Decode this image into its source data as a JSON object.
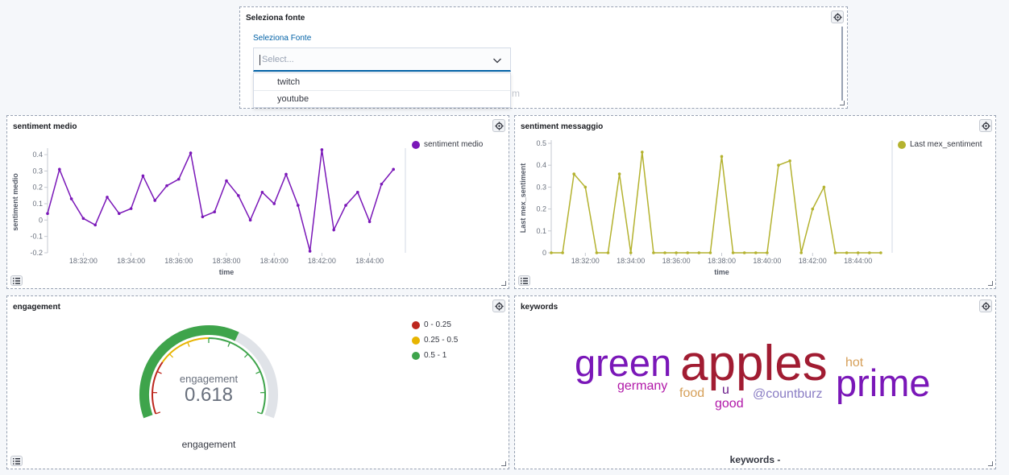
{
  "source_panel": {
    "title": "Seleziona fonte",
    "field_label": "Seleziona Fonte",
    "placeholder": "Select...",
    "options": [
      "twitch",
      "youtube"
    ],
    "hidden_fragment": "m"
  },
  "sentiment_medio": {
    "title": "sentiment medio",
    "chart_data": {
      "type": "line",
      "xlabel": "time",
      "ylabel": "sentiment medio",
      "x_ticks": [
        "18:32:00",
        "18:34:00",
        "18:36:00",
        "18:38:00",
        "18:40:00",
        "18:42:00",
        "18:44:00"
      ],
      "y_ticks": [
        "0.4",
        "0.3",
        "0.2",
        "0.1",
        "0",
        "-0.1",
        "-0.2"
      ],
      "ylim": [
        -0.2,
        0.42
      ],
      "xlim": [
        "18:30:30",
        "18:45:30"
      ],
      "series": [
        {
          "name": "sentiment medio",
          "color": "#7a17b8",
          "points": [
            [
              "18:30:30",
              0.04
            ],
            [
              "18:31:00",
              0.31
            ],
            [
              "18:31:30",
              0.13
            ],
            [
              "18:32:00",
              0.01
            ],
            [
              "18:32:30",
              -0.03
            ],
            [
              "18:33:00",
              0.14
            ],
            [
              "18:33:30",
              0.04
            ],
            [
              "18:34:00",
              0.07
            ],
            [
              "18:34:30",
              0.27
            ],
            [
              "18:35:00",
              0.12
            ],
            [
              "18:35:30",
              0.21
            ],
            [
              "18:36:00",
              0.25
            ],
            [
              "18:36:30",
              0.41
            ],
            [
              "18:37:00",
              0.02
            ],
            [
              "18:37:30",
              0.05
            ],
            [
              "18:38:00",
              0.24
            ],
            [
              "18:38:30",
              0.15
            ],
            [
              "18:39:00",
              0.0
            ],
            [
              "18:39:30",
              0.17
            ],
            [
              "18:40:00",
              0.1
            ],
            [
              "18:40:30",
              0.28
            ],
            [
              "18:41:00",
              0.09
            ],
            [
              "18:41:30",
              -0.19
            ],
            [
              "18:42:00",
              0.43
            ],
            [
              "18:42:30",
              -0.06
            ],
            [
              "18:43:00",
              0.09
            ],
            [
              "18:43:30",
              0.17
            ],
            [
              "18:44:00",
              -0.01
            ],
            [
              "18:44:30",
              0.22
            ],
            [
              "18:45:00",
              0.31
            ]
          ]
        }
      ],
      "legend": "top-right"
    }
  },
  "sentiment_messaggio": {
    "title": "sentiment messaggio",
    "chart_data": {
      "type": "line",
      "xlabel": "time",
      "ylabel": "Last mex_sentiment",
      "x_ticks": [
        "18:32:00",
        "18:34:00",
        "18:36:00",
        "18:38:00",
        "18:40:00",
        "18:42:00",
        "18:44:00"
      ],
      "y_ticks": [
        "0.5",
        "0.4",
        "0.3",
        "0.2",
        "0.1",
        "0"
      ],
      "ylim": [
        0,
        0.5
      ],
      "xlim": [
        "18:30:30",
        "18:45:30"
      ],
      "series": [
        {
          "name": "Last mex_sentiment",
          "color": "#b4b22f",
          "points": [
            [
              "18:30:30",
              0
            ],
            [
              "18:31:00",
              0
            ],
            [
              "18:31:30",
              0.36
            ],
            [
              "18:32:00",
              0.3
            ],
            [
              "18:32:30",
              0
            ],
            [
              "18:33:00",
              0
            ],
            [
              "18:33:30",
              0.36
            ],
            [
              "18:34:00",
              0
            ],
            [
              "18:34:30",
              0.46
            ],
            [
              "18:35:00",
              0
            ],
            [
              "18:35:30",
              0
            ],
            [
              "18:36:00",
              0
            ],
            [
              "18:36:30",
              0
            ],
            [
              "18:37:00",
              0
            ],
            [
              "18:37:30",
              0
            ],
            [
              "18:38:00",
              0.44
            ],
            [
              "18:38:30",
              0
            ],
            [
              "18:39:00",
              0
            ],
            [
              "18:39:30",
              0
            ],
            [
              "18:40:00",
              0
            ],
            [
              "18:40:30",
              0.4
            ],
            [
              "18:41:00",
              0.42
            ],
            [
              "18:41:30",
              0
            ],
            [
              "18:42:00",
              0.2
            ],
            [
              "18:42:30",
              0.3
            ],
            [
              "18:43:00",
              0
            ],
            [
              "18:43:30",
              0
            ],
            [
              "18:44:00",
              0
            ],
            [
              "18:44:30",
              0
            ],
            [
              "18:45:00",
              0
            ]
          ]
        }
      ],
      "legend": "top-right"
    }
  },
  "engagement": {
    "title": "engagement",
    "gauge_label": "engagement",
    "value": 0.618,
    "value_text": "0.618",
    "bottom_label": "engagement",
    "range": [
      0,
      1
    ],
    "legend": [
      {
        "label": "0 - 0.25",
        "color": "#bd271e"
      },
      {
        "label": "0.25 - 0.5",
        "color": "#e7b400"
      },
      {
        "label": "0.5 - 1",
        "color": "#3ea44b"
      }
    ]
  },
  "keywords": {
    "title": "keywords",
    "footer": "keywords -",
    "words": [
      {
        "text": "apples",
        "color": "#a11c32"
      },
      {
        "text": "green",
        "color": "#7a17b8"
      },
      {
        "text": "prime",
        "color": "#7a17b8"
      },
      {
        "text": "germany",
        "color": "#b118a8"
      },
      {
        "text": "food",
        "color": "#d6a05a"
      },
      {
        "text": "u",
        "color": "#6a1c8a"
      },
      {
        "text": "good",
        "color": "#b118a8"
      },
      {
        "text": "@countburz",
        "color": "#8a7dc4"
      },
      {
        "text": "hot",
        "color": "#d6a05a"
      }
    ]
  }
}
